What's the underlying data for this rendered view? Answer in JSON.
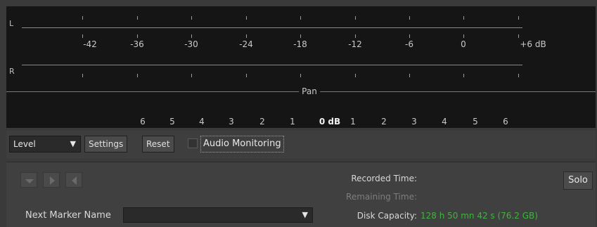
{
  "meter": {
    "left_label": "L",
    "right_label": "R",
    "db_scale": [
      "-42",
      "-36",
      "-30",
      "-24",
      "-18",
      "-12",
      "-6",
      "0",
      "+6 dB"
    ],
    "pan_label": "Pan",
    "pan_scale": [
      "6",
      "5",
      "4",
      "3",
      "2",
      "1",
      "0 dB",
      "1",
      "2",
      "3",
      "4",
      "5",
      "6"
    ]
  },
  "toolbar": {
    "mode_select": "Level",
    "settings_label": "Settings",
    "reset_label": "Reset",
    "monitoring_label": "Audio Monitoring",
    "monitoring_checked": false
  },
  "transport": {
    "buttons": [
      "down-arrow-icon",
      "play-icon",
      "rewind-icon"
    ]
  },
  "info": {
    "recorded_time_label": "Recorded Time:",
    "remaining_time_label": "Remaining Time:",
    "disk_capacity_label": "Disk Capacity:",
    "disk_capacity_value": "128 h 50 mn 42 s (76.2 GB)"
  },
  "solo_label": "Solo",
  "marker": {
    "label": "Next Marker Name",
    "value": ""
  },
  "colors": {
    "meter_bg": "#151515",
    "panel_bg": "#404040",
    "value_green": "#3fb43f"
  }
}
